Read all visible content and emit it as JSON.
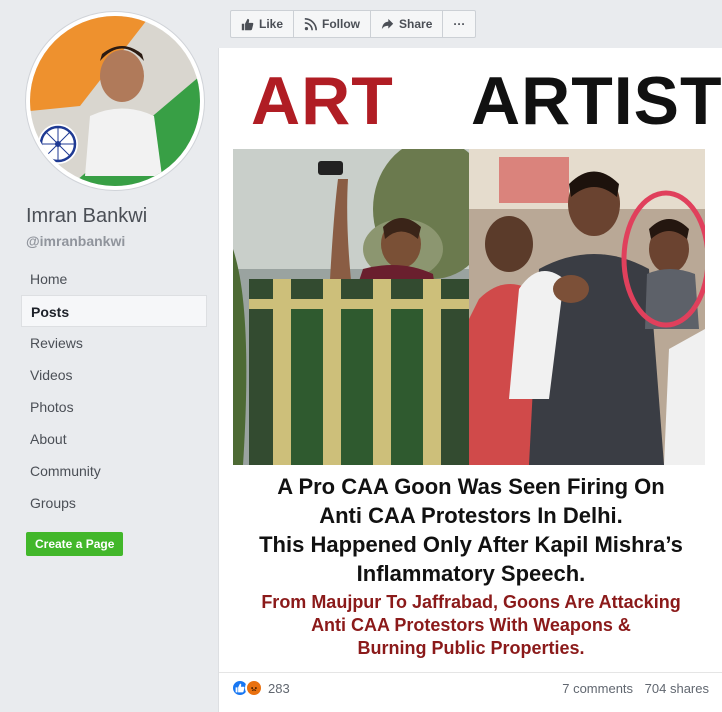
{
  "page": {
    "name": "Imran Bankwi",
    "handle": "@imranbankwi"
  },
  "nav": {
    "items": [
      "Home",
      "Posts",
      "Reviews",
      "Videos",
      "Photos",
      "About",
      "Community",
      "Groups"
    ],
    "active": "Posts"
  },
  "create_page_label": "Create a Page",
  "actionbar": {
    "like": "Like",
    "follow": "Follow",
    "share": "Share",
    "more": "···"
  },
  "post": {
    "headline_left": "ART",
    "headline_right": "ARTIST",
    "caption_lines": [
      "A Pro CAA Goon Was Seen Firing On",
      "Anti CAA Protestors In Delhi.",
      "This Happened Only After Kapil Mishra’s",
      "Inflammatory Speech."
    ],
    "subcaption_lines": [
      "From Maujpur To Jaffrabad, Goons Are Attacking",
      "Anti CAA Protestors With Weapons &",
      "Burning Public Properties."
    ],
    "reaction_count": "283",
    "comments": "7 comments",
    "shares": "704 shares"
  },
  "colors": {
    "accent_green": "#42b72a",
    "headline_red": "#b01d24",
    "subcaption_red": "#8b1a1a",
    "like_blue": "#1877f2",
    "circle_highlight": "#e0405c"
  },
  "icons": [
    "thumbs-up-icon",
    "rss-icon",
    "share-arrow-icon",
    "like-reaction-icon",
    "angry-reaction-icon",
    "ashoka-chakra-icon"
  ]
}
